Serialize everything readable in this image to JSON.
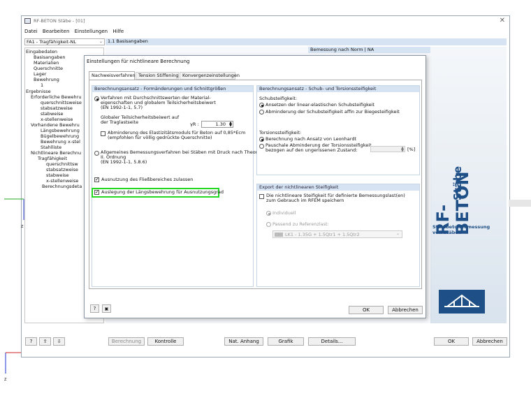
{
  "window": {
    "title": "RF-BETON Stäbe - [01]",
    "menu": [
      "Datei",
      "Bearbeiten",
      "Einstellungen",
      "Hilfe"
    ],
    "case_select": "FA1 - Tragfähigkeit-NL",
    "panel_title": "1.1 Basisangaben",
    "bg_header": "Bemessung nach Norm | NA"
  },
  "tree": [
    "Eingabedaten",
    "Basisangaben",
    "Materialien",
    "Querschnitte",
    "Lager",
    "Bewehrung",
    "1",
    "Ergebnisse",
    "Erforderliche Bewehru",
    "querschnittsweise",
    "stabsatzweise",
    "stabweise",
    "x-stellenweise",
    "Vorhandene Bewehru",
    "Längsbewehrung",
    "Bügelbewehrung",
    "Bewehrung x-stel",
    "Stahlliste",
    "Nichtlineare Berechnu",
    "Tragfähigkeit",
    "querschnittsw",
    "stabsatzweise",
    "stabweise",
    "x-stellenweise",
    "Berechnungsdeta"
  ],
  "brand": {
    "logo": "RF-BETON",
    "subtitle": "Stäbe",
    "desc_line1": "Stahlbetonbemessung",
    "desc_line2": "von Stäben"
  },
  "bottom_bar": {
    "berechnung": "Berechnung",
    "kontrolle": "Kontrolle",
    "nat_anhang": "Nat. Anhang",
    "grafik": "Grafik",
    "details": "Details...",
    "ok": "OK",
    "abbrechen": "Abbrechen"
  },
  "axis": {
    "z_label": "Z"
  },
  "dialog": {
    "title": "Einstellungen für nichtlineare Berechnung",
    "tabs": [
      "Nachweisverfahren",
      "Tension Stiffening",
      "Konvergenzeinstellungen"
    ],
    "left": {
      "header": "Berechnungsansatz - Formänderungen und Schnittgrößen",
      "opt1_line1": "Verfahren mit Durchschnittswerten der Material-",
      "opt1_line2": "eigenschaften und globalem Teilsicherheitsbeiwert",
      "opt1_line3": "(EN 1992-1-1, 5.7)",
      "gamma_line1": "Globaler Teilsicherheitsbeiwert auf",
      "gamma_line2": "der Traglastseite",
      "gamma_symbol": "γR :",
      "gamma_value": "1.30",
      "abm_line1": "Abminderung des Elastizitätsmoduls für Beton auf 0,85*Ecm",
      "abm_line2": "(empfohlen für völlig gedrückte Querschnitte)",
      "opt2_line1": "Allgemeines Bemessungsverfahren bei Stäben mit Druck nach Theorie",
      "opt2_line2": "II. Ordnung",
      "opt2_line3": "(EN 1992-1-1, 5.8.6)",
      "fliess": "Ausnutzung des Fließbereiches zulassen",
      "auslegung": "Auslegung der Längsbewehrung für Ausnutzungsgrad"
    },
    "right": {
      "header": "Berechnungsansatz - Schub- und Torsionssteifigkeit",
      "schub_label": "Schubsteifigkeit:",
      "schub1": "Ansetzen der linear-elastischen Schubsteifigkeit",
      "schub2": "Abminderung der Schubsteifigkeit affin zur Biegesteifigkeit",
      "torsion_label": "Torsionssteifigkeit:",
      "torsion1": "Berechnung nach Ansatz von Leonhardt",
      "torsion2_line1": "Pauschale Abminderung der Torsionssteifigkeit",
      "torsion2_line2": "bezogen auf den ungerissenen Zustand:",
      "torsion_unit": "[%]"
    },
    "export": {
      "header": "Export der nichtlinearen Steifigkeit",
      "check_line1": "Die nichtlineare Steifigkeit für definierte Bemessungslast(en)",
      "check_line2": "zum Gebrauch im RFEM speichern",
      "individuell": "Individuell",
      "passend": "Passend zu Referenzlast:",
      "lk_value": "LK1 - 1.35G + 1.5Qtr1 + 1.5Qtr2"
    },
    "buttons": {
      "ok": "OK",
      "abbrechen": "Abbrechen"
    }
  },
  "colors": {
    "accent_green": "#22d822",
    "section_header": "#d5e3f2",
    "brand_blue": "#1e4f86"
  }
}
